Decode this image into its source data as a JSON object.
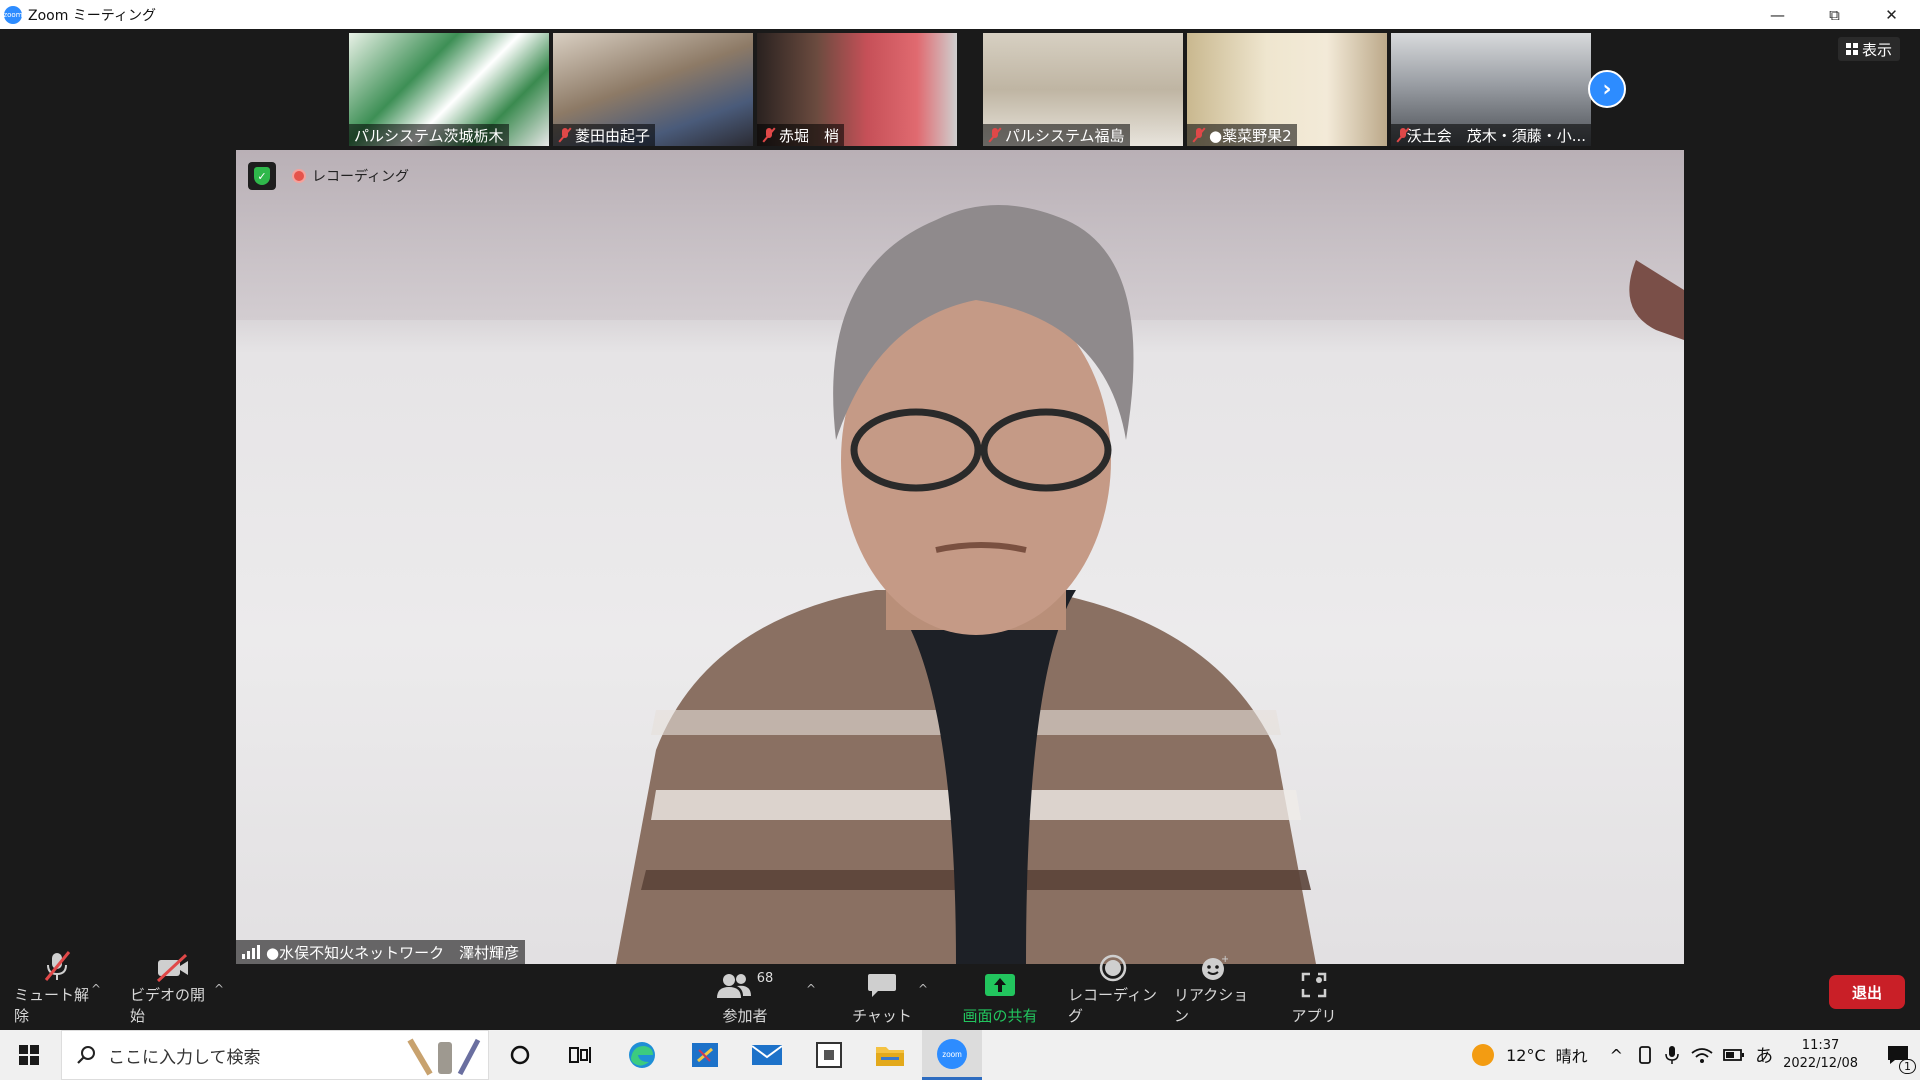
{
  "window": {
    "title": "Zoom ミーティング",
    "app_icon_text": "zoom"
  },
  "thumbnails": [
    {
      "name": "パルシステム茨城栃木",
      "muted": false,
      "bg": "#6fa87a"
    },
    {
      "name": "菱田由起子",
      "muted": true,
      "bg": "#8a7763"
    },
    {
      "name": "赤堀　梢",
      "muted": true,
      "bg": "#b0464f"
    },
    {
      "name": "パルシステム福島",
      "muted": true,
      "bg": "#c7bfae"
    },
    {
      "name": "●薬菜野果2",
      "muted": true,
      "bg": "#cdbf98"
    },
    {
      "name": "沃土会　茂木・須藤・小...",
      "muted": true,
      "bg": "#7f8388"
    }
  ],
  "view_button": {
    "label": "表示"
  },
  "main_video": {
    "recording_label": "レコーディング",
    "participant_name": "●水俣不知火ネットワーク　澤村輝彦"
  },
  "toolbar": {
    "mute_label": "ミュート解除",
    "video_label": "ビデオの開始",
    "participants_label": "参加者",
    "participants_count": "68",
    "chat_label": "チャット",
    "share_label": "画面の共有",
    "record_label": "レコーディング",
    "reactions_label": "リアクション",
    "apps_label": "アプリ",
    "leave_label": "退出",
    "share_color": "#22c55e"
  },
  "taskbar": {
    "search_placeholder": "ここに入力して検索",
    "weather_temp": "12°C",
    "weather_text": "晴れ",
    "ime": "あ",
    "time": "11:37",
    "date": "2022/12/08",
    "notification_count": "1"
  }
}
